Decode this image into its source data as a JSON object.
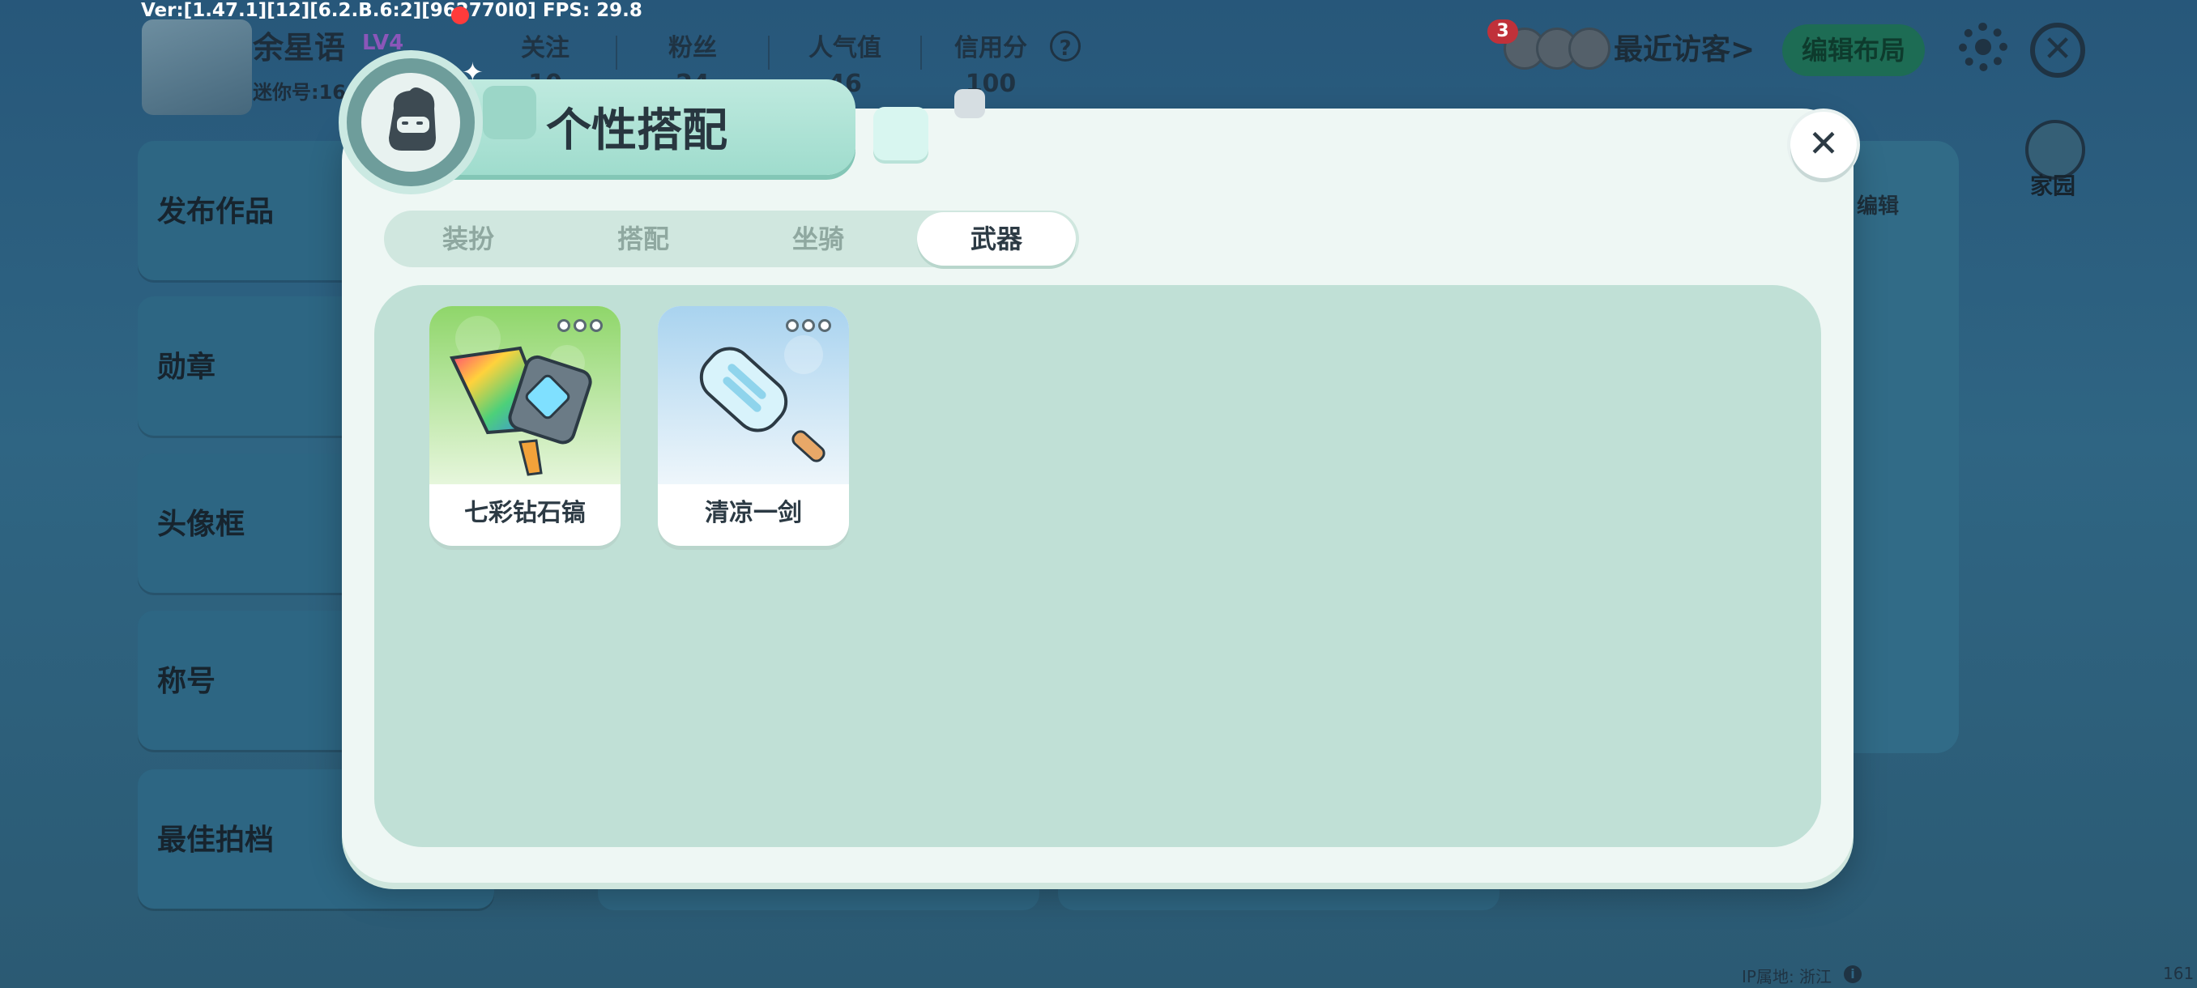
{
  "debug": {
    "version_text": "Ver:[1.47.1][12][6.2.B.6:2][962770I0] FPS: 29.8"
  },
  "profile": {
    "username": "余星语",
    "level": "LV4",
    "mini_id": "迷你号:16",
    "stats": [
      {
        "label": "关注",
        "value": "10"
      },
      {
        "label": "粉丝",
        "value": "24"
      },
      {
        "label": "人气值",
        "value": "46"
      },
      {
        "label": "信用分",
        "value": "100"
      }
    ],
    "help": "?"
  },
  "header": {
    "visitor_count": "3",
    "recent_visitors": "最近访客>",
    "edit_layout": "编辑布局",
    "close": "✕",
    "home": "家园",
    "edit": "编辑"
  },
  "sidebar": {
    "items": [
      {
        "label": "发布作品"
      },
      {
        "label": "勋章"
      },
      {
        "label": "头像框"
      },
      {
        "label": "称号"
      },
      {
        "label": "最佳拍档"
      }
    ]
  },
  "footer": {
    "ip_label": "IP属地: 浙江",
    "info": "i",
    "corner": "161"
  },
  "modal": {
    "title": "个性搭配",
    "close": "✕",
    "tabs": [
      {
        "label": "装扮",
        "active": false
      },
      {
        "label": "搭配",
        "active": false
      },
      {
        "label": "坐骑",
        "active": false
      },
      {
        "label": "武器",
        "active": true
      }
    ],
    "items": [
      {
        "name": "七彩钻石镐",
        "icon": "rainbow-pickaxe-icon",
        "bg": "#8fd66a"
      },
      {
        "name": "清凉一剑",
        "icon": "popsicle-sword-icon",
        "bg": "#a9d3ef"
      }
    ]
  },
  "colors": {
    "accent": "#9fdccd",
    "panel": "#c0e0d6",
    "modal": "#eef7f4"
  }
}
